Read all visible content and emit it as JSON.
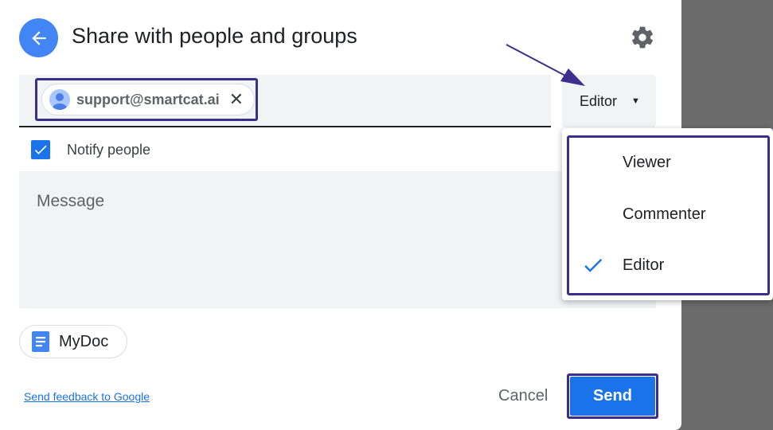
{
  "dialog": {
    "title": "Share with people and groups",
    "back_icon": "arrow-left-icon",
    "settings_icon": "gear-icon"
  },
  "recipients": {
    "chips": [
      {
        "email": "support@smartcat.ai",
        "avatar_icon": "person-icon",
        "remove_icon": "close-icon"
      }
    ],
    "role": "Editor",
    "role_caret_icon": "caret-down-icon"
  },
  "role_menu": {
    "items": [
      {
        "label": "Viewer",
        "selected": false
      },
      {
        "label": "Commenter",
        "selected": false
      },
      {
        "label": "Editor",
        "selected": true
      }
    ]
  },
  "notify": {
    "label": "Notify people",
    "checked": true
  },
  "message": {
    "placeholder": "Message"
  },
  "attachment": {
    "name": "MyDoc",
    "icon": "google-docs-icon"
  },
  "footer": {
    "feedback_link": "Send feedback to Google",
    "cancel_label": "Cancel",
    "send_label": "Send"
  },
  "colors": {
    "accent": "#1a73e8",
    "annotation": "#3d2d8c",
    "overlay": "#6b6b6b"
  }
}
